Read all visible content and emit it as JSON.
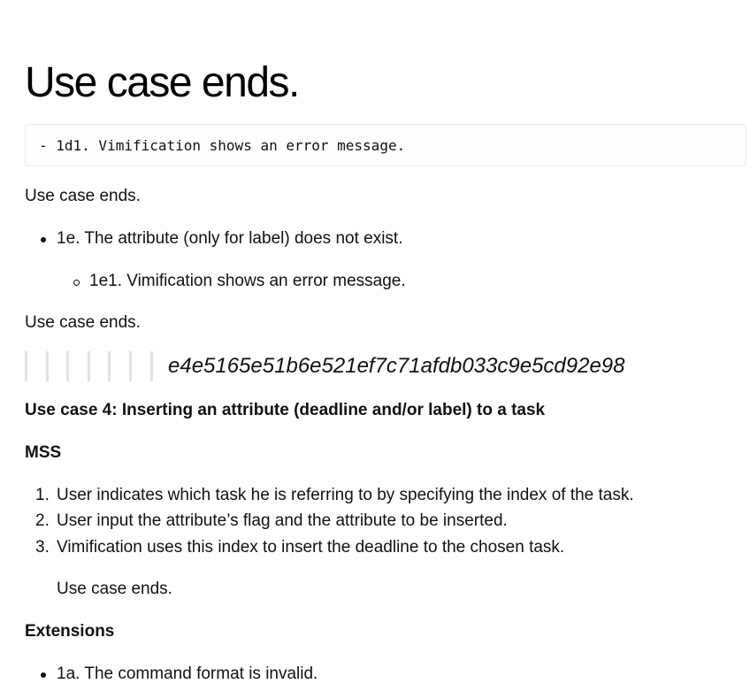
{
  "heading": "Use case ends.",
  "code_line": "- 1d1. Vimification shows an error message.",
  "para_1": "Use case ends.",
  "bullet_1e": "1e. The attribute (only for label) does not exist.",
  "sub_bullet_1e1": "1e1. Vimification shows an error message.",
  "para_2": "Use case ends.",
  "commit_hash": "e4e5165e51b6e521ef7c71afdb033c9e5cd92e98",
  "use_case_4_title": "Use case 4: Inserting an attribute (deadline and/or label) to a task",
  "mss_label": "MSS",
  "mss_steps": [
    {
      "num": "1.",
      "text": "User indicates which task he is referring to by specifying the index of the task."
    },
    {
      "num": "2.",
      "text": "User input the attribute’s flag and the attribute to be inserted."
    },
    {
      "num": "3.",
      "text": "Vimification uses this index to insert the deadline to the chosen task."
    }
  ],
  "mss_end": "Use case ends.",
  "extensions_label": "Extensions",
  "bullet_1a": "1a. The command format is invalid."
}
